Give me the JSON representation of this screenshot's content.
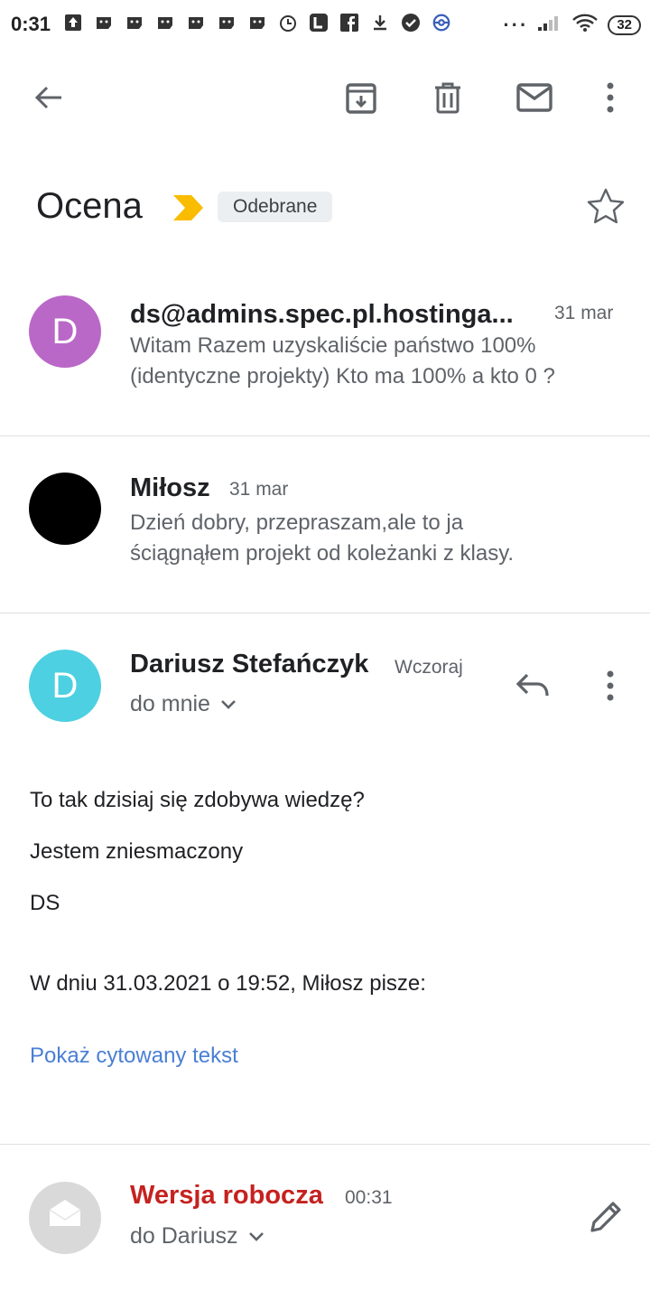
{
  "status_bar": {
    "time": "0:31",
    "battery": "32"
  },
  "toolbar": {
    "back": "arrow-back-icon",
    "archive": "archive-icon",
    "delete": "trash-icon",
    "mark_unread": "mail-icon",
    "more": "more-vert-icon"
  },
  "subject": {
    "title": "Ocena",
    "label": "Odebrane"
  },
  "messages": [
    {
      "avatar_letter": "D",
      "avatar_color": "#ba68c8",
      "sender": "ds@admins.spec.pl.hostinga...",
      "date": "31 mar",
      "snippet_line1": "Witam Razem uzyskaliście państwo 100%",
      "snippet_line2": "(identyczne projekty) Kto ma 100% a kto 0 ?"
    },
    {
      "avatar_color": "#000000",
      "sender": "Miłosz",
      "date": "31 mar",
      "snippet_line1": "Dzień dobry, przepraszam,ale to ja",
      "snippet_line2": "ściągnąłem projekt od koleżanki z klasy."
    }
  ],
  "open_message": {
    "avatar_letter": "D",
    "avatar_color": "#4dd0e1",
    "sender": "Dariusz Stefańczyk",
    "date": "Wczoraj",
    "to": "do mnie",
    "body": [
      "To tak dzisiaj się zdobywa wiedzę?",
      "Jestem zniesmaczony",
      "DS"
    ],
    "quote_header": "W dniu 31.03.2021 o 19:52, Miłosz pisze:",
    "show_quoted": "Pokaż cytowany tekst"
  },
  "draft": {
    "label": "Wersja robocza",
    "time": "00:31",
    "to": "do Dariusz",
    "label_color": "#c5221f"
  }
}
